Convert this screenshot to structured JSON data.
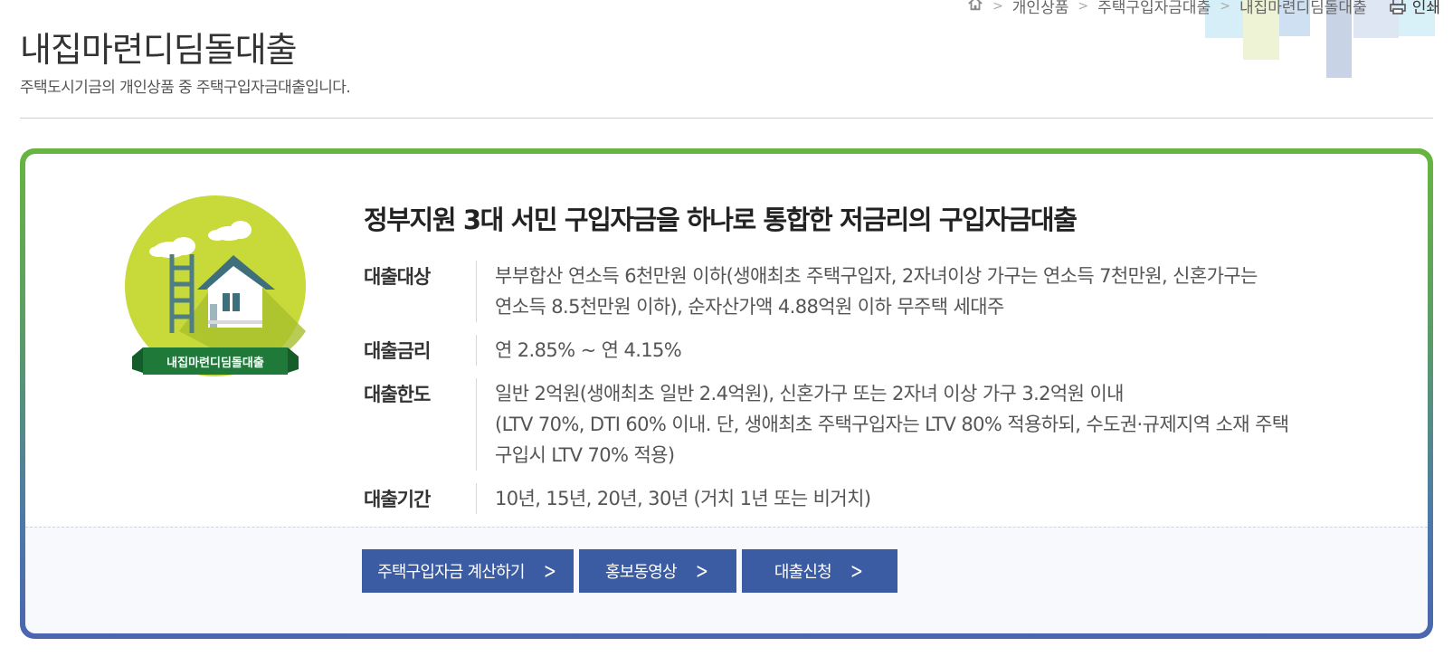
{
  "breadcrumb": {
    "items": [
      "개인상품",
      "주택구입자금대출",
      "내집마련디딤돌대출"
    ],
    "print_label": "인쇄"
  },
  "page": {
    "title": "내집마련디딤돌대출",
    "subtitle": "주택도시기금의 개인상품 중 주택구입자금대출입니다."
  },
  "badge": {
    "ribbon_text": "내집마련디딤돌대출"
  },
  "product": {
    "headline": "정부지원 3대 서민 구입자금을 하나로 통합한 저금리의 구입자금대출",
    "details": [
      {
        "label": "대출대상",
        "lines": [
          "부부합산 연소득 6천만원 이하(생애최초 주택구입자, 2자녀이상 가구는 연소득 7천만원, 신혼가구는",
          "연소득 8.5천만원 이하), 순자산가액 4.88억원 이하 무주택 세대주"
        ]
      },
      {
        "label": "대출금리",
        "lines": [
          "연 2.85% ~ 연 4.15%"
        ]
      },
      {
        "label": "대출한도",
        "lines": [
          "일반 2억원(생애최초 일반 2.4억원), 신혼가구 또는 2자녀 이상 가구 3.2억원 이내",
          "(LTV 70%, DTI 60% 이내. 단, 생애최초 주택구입자는 LTV 80% 적용하되, 수도권·규제지역 소재 주택",
          "구입시 LTV 70% 적용)"
        ]
      },
      {
        "label": "대출기간",
        "lines": [
          "10년, 15년, 20년, 30년 (거치 1년 또는 비거치)"
        ]
      }
    ]
  },
  "buttons": {
    "calculator": "주택구입자금 계산하기",
    "video": "홍보동영상",
    "apply": "대출신청"
  },
  "colors": {
    "primary_button": "#3b5ba2",
    "badge_green": "#c8d93a",
    "ribbon_green": "#1f7a3a",
    "border_top": "#67b53f",
    "border_bottom": "#4a66b0"
  }
}
